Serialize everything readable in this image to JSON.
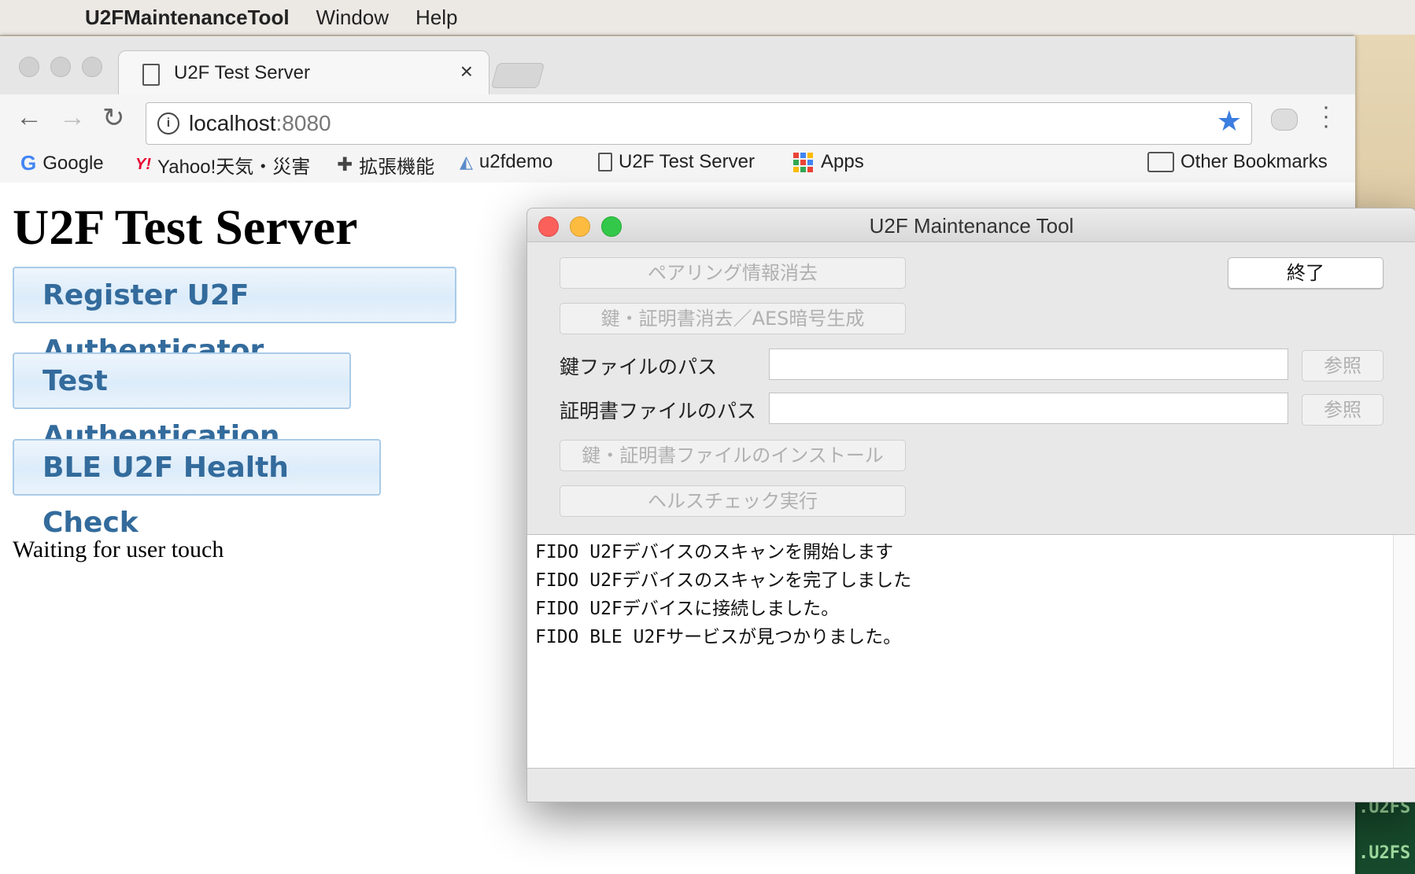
{
  "menubar": {
    "app_name": "U2FMaintenanceTool",
    "items": [
      "Window",
      "Help"
    ]
  },
  "browser": {
    "tab_title": "U2F Test Server",
    "url_host": "localhost",
    "url_port": ":8080",
    "bookmarks": [
      {
        "label": "Google"
      },
      {
        "label": "Yahoo!天気・災害"
      },
      {
        "label": "拡張機能"
      },
      {
        "label": "u2fdemo"
      },
      {
        "label": "U2F Test Server"
      },
      {
        "label": "Apps"
      },
      {
        "label": "Other Bookmarks"
      }
    ]
  },
  "page": {
    "title": "U2F Test Server",
    "buttons": [
      "Register U2F Authenticator",
      "Test Authentication",
      "BLE U2F Health Check"
    ],
    "status": "Waiting for user touch"
  },
  "tool": {
    "window_title": "U2F Maintenance Tool",
    "clear_pairing": "ペアリング情報消去",
    "clear_keys": "鍵・証明書消去／AES暗号生成",
    "quit": "終了",
    "key_path_label": "鍵ファイルのパス",
    "cert_path_label": "証明書ファイルのパス",
    "browse": "参照",
    "install": "鍵・証明書ファイルのインストール",
    "health_check": "ヘルスチェック実行",
    "log": [
      "FIDO U2Fデバイスのスキャンを開始します",
      "FIDO U2Fデバイスのスキャンを完了しました",
      "FIDO U2Fデバイスに接続しました。",
      "FIDO BLE U2Fサービスが見つかりました。"
    ]
  },
  "desktop": {
    "terminal_lines": [
      ".U2FS",
      ".U2FS"
    ]
  },
  "colors": {
    "button_text": "#336b9c",
    "close": "#fc605b",
    "minimize": "#fdbc40",
    "zoom": "#34c84a",
    "star": "#3b7de0"
  }
}
